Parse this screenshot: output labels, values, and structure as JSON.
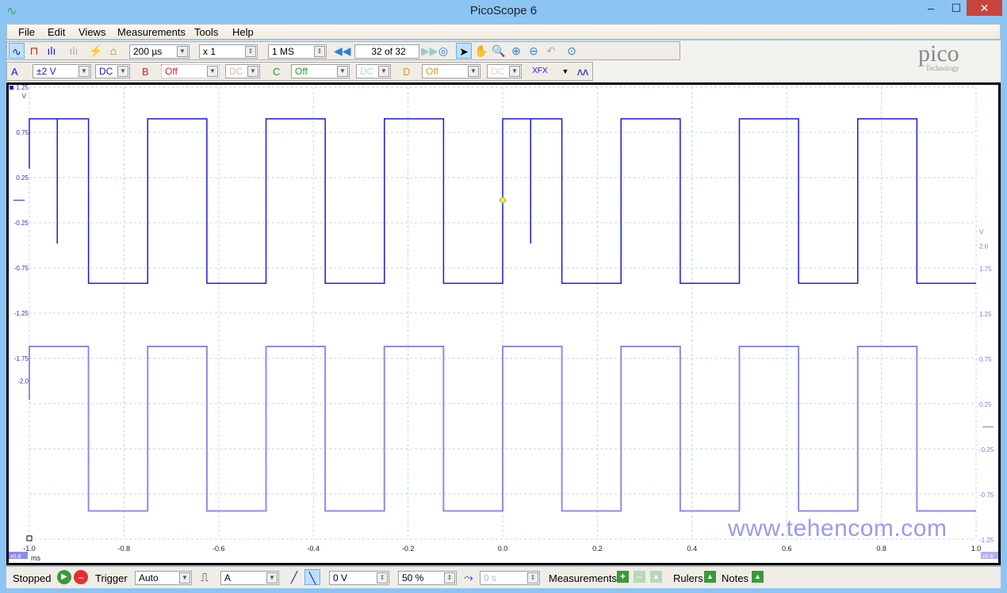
{
  "window": {
    "title": "PicoScope 6",
    "minimize": "–",
    "maximize": "☐",
    "close": "✕"
  },
  "menu": [
    "File",
    "Edit",
    "Views",
    "Measurements",
    "Tools",
    "Help"
  ],
  "toolbar": {
    "timebase": "200 µs",
    "zoom_factor": "x 1",
    "samples": "1 MS",
    "buffer": "32 of 32"
  },
  "channels": {
    "A": {
      "label": "A",
      "range": "±2 V",
      "coupling": "DC",
      "color": "#1a1adc"
    },
    "B": {
      "label": "B",
      "range": "Off",
      "coupling": "DC",
      "color": "#e02020"
    },
    "C": {
      "label": "C",
      "range": "Off",
      "coupling": "DC",
      "color": "#20a020"
    },
    "D": {
      "label": "D",
      "range": "Off",
      "coupling": "DC",
      "color": "#d0a020"
    }
  },
  "logo": {
    "text": "pico",
    "sub": "Technology"
  },
  "status": {
    "state": "Stopped",
    "trigger_label": "Trigger",
    "trigger_mode": "Auto",
    "trigger_source": "A",
    "threshold": "0 V",
    "pre_trigger": "50 %",
    "delay": "0 s",
    "measurements": "Measurements",
    "rulers": "Rulers",
    "notes": "Notes"
  },
  "watermark": "www.tehencom.com",
  "chart_data": {
    "type": "line",
    "xlabel": "ms",
    "xlim": [
      -1.0,
      1.0
    ],
    "xticks": [
      "-1.0",
      "-0.8",
      "-0.6",
      "-0.4",
      "-0.2",
      "0.0",
      "0.2",
      "0.4",
      "0.6",
      "0.8",
      "1.0"
    ],
    "left_axis": {
      "unit": "V",
      "range": [
        -2.0,
        1.25
      ],
      "ticks": [
        "1.25",
        "0.75",
        "0.25",
        "-0.25",
        "-0.75",
        "-1.25",
        "-1.75",
        "-2.0"
      ],
      "tick_values": [
        1.25,
        0.75,
        0.25,
        -0.25,
        -0.75,
        -1.25,
        -1.75,
        -2.0
      ]
    },
    "right_axis": {
      "unit": "V",
      "range": [
        -1.25,
        2.0
      ],
      "ticks": [
        "2.0",
        "1.75",
        "1.25",
        "0.75",
        "0.25",
        "-0.25",
        "-0.75",
        "-1.25"
      ],
      "tick_values": [
        2.0,
        1.75,
        1.25,
        0.75,
        0.25,
        -0.25,
        -0.75,
        -1.25
      ]
    },
    "zoom_badge": "x0.8",
    "grid": true,
    "series": [
      {
        "axis": "left",
        "color": "#1a1adc",
        "high": 0.9,
        "low": -0.92,
        "start": 0.35,
        "first_edge": -0.875,
        "half_period": 0.125,
        "glitches": [
          {
            "t": -0.941,
            "v": -0.48
          },
          {
            "t": 0.059,
            "v": -0.48
          }
        ]
      },
      {
        "axis": "right",
        "color": "#8c8ce8",
        "high": 0.89,
        "low": -0.93,
        "start": 0.3,
        "first_edge": -0.875,
        "half_period": 0.125,
        "glitches": []
      }
    ],
    "trigger_marker": {
      "t": 0.0,
      "v": 0.0
    }
  }
}
